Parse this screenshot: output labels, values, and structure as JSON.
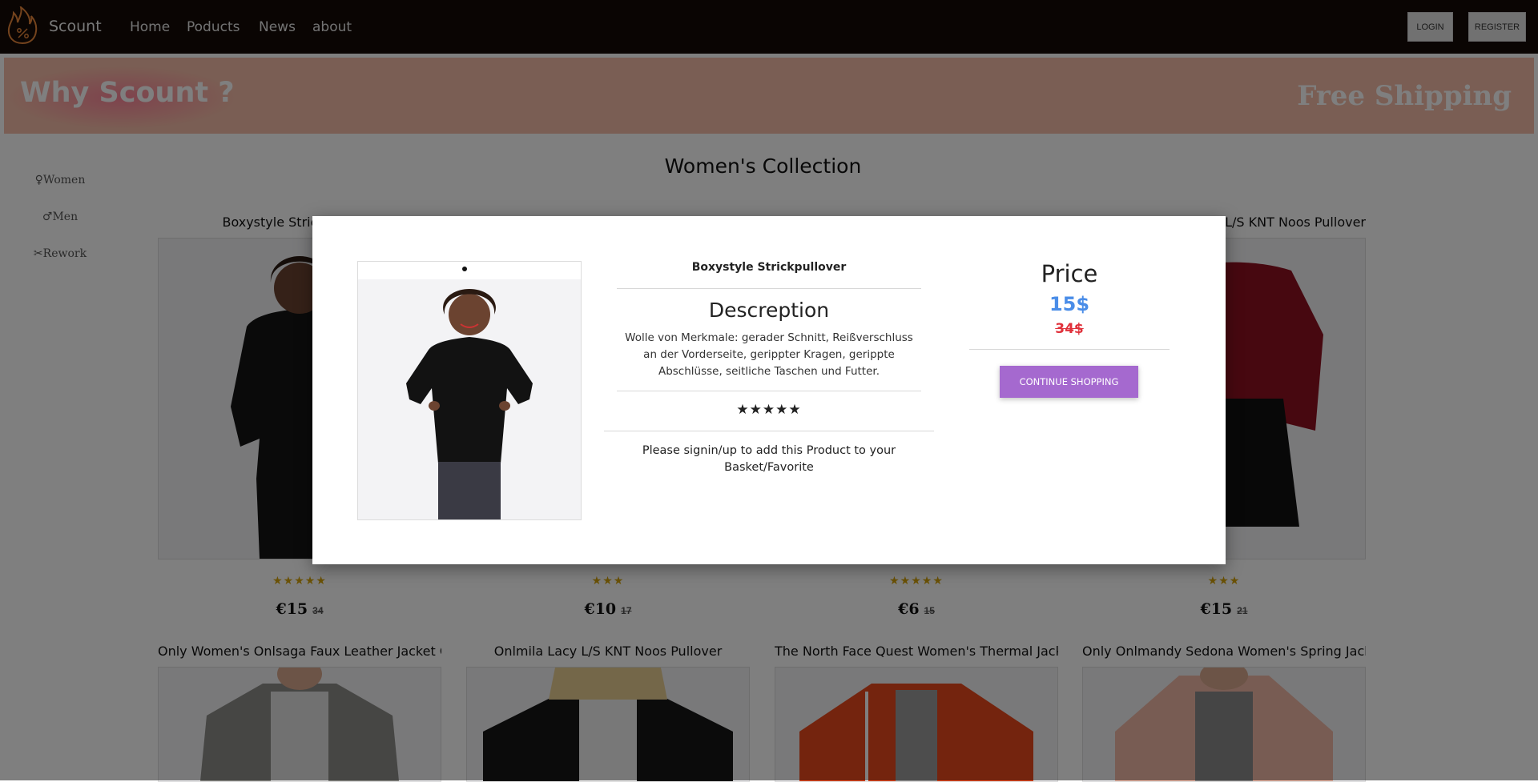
{
  "nav": {
    "brand": "Scount",
    "links": [
      "Home",
      "Poducts",
      "News",
      "about"
    ],
    "login": "LOGIN",
    "register": "REGISTER"
  },
  "banner": {
    "left": "Why Scount ?",
    "right": "Free Shipping"
  },
  "sidebar": {
    "items": [
      {
        "icon": "female-symbol-icon",
        "glyph": "♀",
        "label": "Women"
      },
      {
        "icon": "male-symbol-icon",
        "glyph": "♂",
        "label": "Men"
      },
      {
        "icon": "scissors-icon",
        "glyph": "✂",
        "label": "Rework"
      }
    ]
  },
  "main": {
    "title": "Women's Collection",
    "row1": [
      {
        "title": "Boxystyle Strickpullover",
        "stars": "★★★★★",
        "rating": 5,
        "price": "€15",
        "old": "34"
      },
      {
        "title": "",
        "stars": "★★★",
        "rating": 3,
        "price": "€10",
        "old": "17"
      },
      {
        "title": "",
        "stars": "★★★★★",
        "rating": 5,
        "price": "€6",
        "old": "15"
      },
      {
        "title": "Onlmila Lacy L/S KNT Noos Pullover",
        "stars": "★★★",
        "rating": 3,
        "price": "€15",
        "old": "21"
      }
    ],
    "row2": [
      {
        "title": "Only Women's Onlsaga Faux Leather Jacket CC"
      },
      {
        "title": "Onlmila Lacy L/S KNT Noos Pullover"
      },
      {
        "title": "The North Face Quest Women's Thermal Jacket"
      },
      {
        "title": "Only Onlmandy Sedona Women's Spring Jacket"
      }
    ]
  },
  "modal": {
    "product_title": "Boxystyle Strickpullover",
    "description_heading": "Descreption",
    "description": "Wolle von Merkmale: gerader Schnitt, Reißverschluss an der Vorderseite, gerippter Kragen, gerippte Abschlüsse, seitliche Taschen und Futter.",
    "rating_stars": "★★★★★",
    "rating": 5,
    "signin_note": "Please signin/up to add this Product to your Basket/Favorite",
    "price_heading": "Price",
    "price_new": "15$",
    "price_old": "34$",
    "continue_label": "CONTINUE SHOPPING"
  },
  "colors": {
    "navbar": "#140b07",
    "banner": "#f5bda8",
    "accent_button": "#a569cf",
    "price_new": "#4a8de8",
    "price_old": "#e0313b",
    "card_stars": "#d4a20a"
  }
}
